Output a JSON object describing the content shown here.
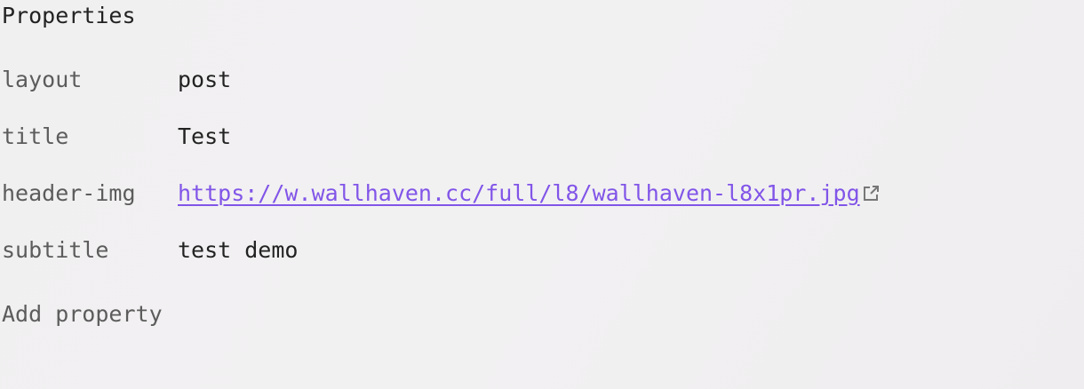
{
  "properties": {
    "heading": "Properties",
    "rows": [
      {
        "key": "layout",
        "value": "post"
      },
      {
        "key": "title",
        "value": "Test"
      },
      {
        "key": "header-img",
        "value": "https://w.wallhaven.cc/full/l8/wallhaven-l8x1pr.jpg"
      },
      {
        "key": "subtitle",
        "value": "test demo"
      }
    ],
    "add_label": "Add property"
  },
  "colors": {
    "link": "#8155e8"
  }
}
